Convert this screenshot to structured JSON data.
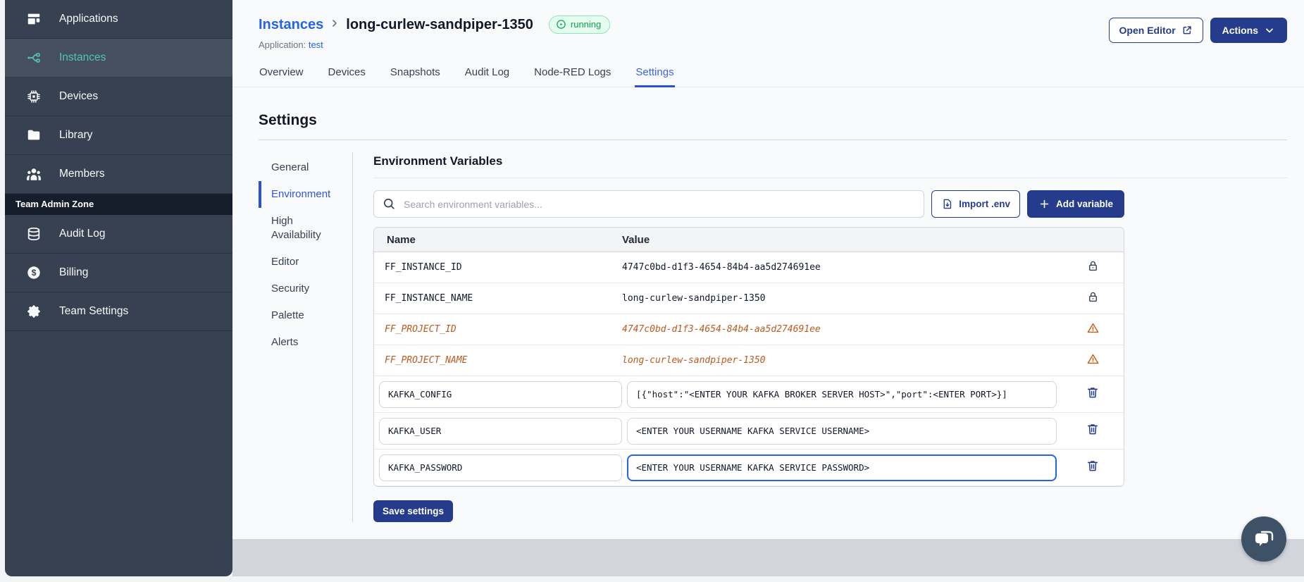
{
  "colors": {
    "sidebar_bg": "#374151",
    "sidebar_active_bg": "#454F5E",
    "sidebar_active_teal": "#57C3B4",
    "admin_zone_bg": "#161D2B",
    "primary_navy": "#253C8C",
    "link_blue": "#2563EB",
    "active_tab_blue": "#2B50DC",
    "status_running_green": "#12A150",
    "deprecated_orange": "#BC5A1F",
    "footer_band": "#D2D6DC"
  },
  "sidebar": {
    "items": [
      {
        "label": "Applications",
        "icon": "applications-icon",
        "active": false
      },
      {
        "label": "Instances",
        "icon": "instances-icon",
        "active": true
      },
      {
        "label": "Devices",
        "icon": "devices-icon",
        "active": false
      },
      {
        "label": "Library",
        "icon": "library-icon",
        "active": false
      },
      {
        "label": "Members",
        "icon": "members-icon",
        "active": false
      }
    ],
    "section_label": "Team Admin Zone",
    "admin_items": [
      {
        "label": "Audit Log",
        "icon": "audit-log-icon",
        "active": false
      },
      {
        "label": "Billing",
        "icon": "billing-icon",
        "active": false
      },
      {
        "label": "Team Settings",
        "icon": "team-settings-icon",
        "active": false
      }
    ]
  },
  "header": {
    "breadcrumb_parent": "Instances",
    "instance_name": "long-curlew-sandpiper-1350",
    "status_badge": "running",
    "application_label": "Application:",
    "application_name": "test",
    "open_editor_label": "Open Editor",
    "actions_label": "Actions"
  },
  "tabs": [
    {
      "label": "Overview",
      "active": false
    },
    {
      "label": "Devices",
      "active": false
    },
    {
      "label": "Snapshots",
      "active": false
    },
    {
      "label": "Audit Log",
      "active": false
    },
    {
      "label": "Node-RED Logs",
      "active": false
    },
    {
      "label": "Settings",
      "active": true
    }
  ],
  "settings": {
    "title": "Settings",
    "nav": [
      {
        "label": "General",
        "active": false
      },
      {
        "label": "Environment",
        "active": true
      },
      {
        "label": "High Availability",
        "active": false
      },
      {
        "label": "Editor",
        "active": false
      },
      {
        "label": "Security",
        "active": false
      },
      {
        "label": "Palette",
        "active": false
      },
      {
        "label": "Alerts",
        "active": false
      }
    ]
  },
  "env": {
    "title": "Environment Variables",
    "search_placeholder": "Search environment variables...",
    "import_label": "Import .env",
    "add_label": "Add variable",
    "save_label": "Save settings",
    "columns": {
      "name": "Name",
      "value": "Value"
    },
    "locked_rows": [
      {
        "name": "FF_INSTANCE_ID",
        "value": "4747c0bd-d1f3-4654-84b4-aa5d274691ee",
        "state": "locked"
      },
      {
        "name": "FF_INSTANCE_NAME",
        "value": "long-curlew-sandpiper-1350",
        "state": "locked"
      },
      {
        "name": "FF_PROJECT_ID",
        "value": "4747c0bd-d1f3-4654-84b4-aa5d274691ee",
        "state": "deprecated"
      },
      {
        "name": "FF_PROJECT_NAME",
        "value": "long-curlew-sandpiper-1350",
        "state": "deprecated"
      }
    ],
    "editable_rows": [
      {
        "name": "KAFKA_CONFIG",
        "value": "[{\"host\":\"<ENTER YOUR KAFKA BROKER SERVER HOST>\",\"port\":<ENTER PORT>}]",
        "focused": false
      },
      {
        "name": "KAFKA_USER",
        "value": "<ENTER YOUR USERNAME KAFKA SERVICE USERNAME>",
        "focused": false
      },
      {
        "name": "KAFKA_PASSWORD",
        "value": "<ENTER YOUR USERNAME KAFKA SERVICE PASSWORD>",
        "focused": true
      }
    ]
  }
}
